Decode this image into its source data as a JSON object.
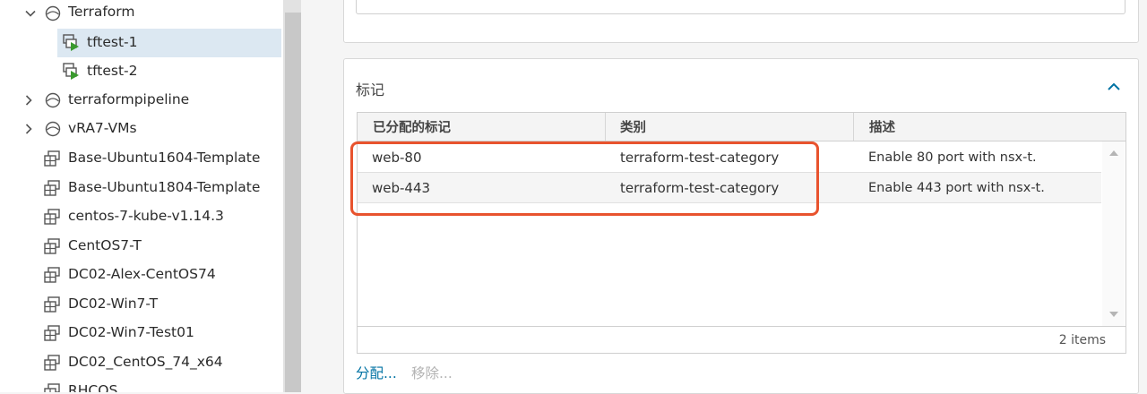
{
  "tree": {
    "items": [
      {
        "label": "Terraform",
        "type": "folder",
        "expanded": true
      },
      {
        "label": "tftest-1",
        "type": "vm",
        "selected": true
      },
      {
        "label": "tftest-2",
        "type": "vm"
      },
      {
        "label": "terraformpipeline",
        "type": "folder",
        "expanded": false
      },
      {
        "label": "vRA7-VMs",
        "type": "folder",
        "expanded": false
      },
      {
        "label": "Base-Ubuntu1604-Template",
        "type": "template"
      },
      {
        "label": "Base-Ubuntu1804-Template",
        "type": "template"
      },
      {
        "label": "centos-7-kube-v1.14.3",
        "type": "template"
      },
      {
        "label": "CentOS7-T",
        "type": "template"
      },
      {
        "label": "DC02-Alex-CentOS74",
        "type": "template"
      },
      {
        "label": "DC02-Win7-T",
        "type": "template"
      },
      {
        "label": "DC02-Win7-Test01",
        "type": "template"
      },
      {
        "label": "DC02_CentOS_74_x64",
        "type": "template"
      },
      {
        "label": "RHCOS",
        "type": "template"
      }
    ]
  },
  "tags_panel": {
    "title": "标记",
    "columns": [
      "已分配的标记",
      "类别",
      "描述"
    ],
    "rows": [
      {
        "tag": "web-80",
        "category": "terraform-test-category",
        "description": "Enable 80 port with nsx-t."
      },
      {
        "tag": "web-443",
        "category": "terraform-test-category",
        "description": "Enable 443 port with nsx-t."
      }
    ],
    "item_count": "2 items",
    "assign_label": "分配...",
    "remove_label": "移除..."
  },
  "colors": {
    "accent": "#0072a3",
    "highlight": "#e8532e",
    "selection": "#dce8f2",
    "vm_green": "#3a9a2e"
  }
}
